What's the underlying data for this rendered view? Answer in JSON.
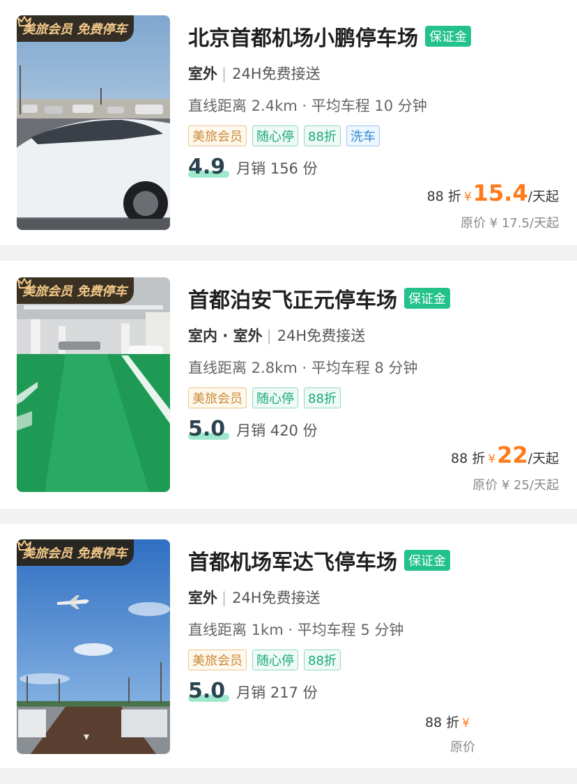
{
  "badge": {
    "text": "美旅会员 免费停车"
  },
  "colors": {
    "deposit_bg": "#23c28a",
    "price": "#ff7a1a",
    "tag_gold": "#c98a3a",
    "tag_green": "#18a878",
    "tag_blue": "#2f87d6",
    "badge_text": "#f3c98a"
  },
  "listings": [
    {
      "name": "北京首都机场小鹏停车场",
      "deposit": "保证金",
      "park_type": "室外",
      "service": "24H免费接送",
      "distance": "直线距离 2.4km · 平均车程 10 分钟",
      "tags": [
        "美旅会员",
        "随心停",
        "88折",
        "洗车"
      ],
      "rating": "4.9",
      "sales": "月销 156 份",
      "discount": "88 折",
      "currency": "¥",
      "price": "15.4",
      "unit": "/天起",
      "original": "原价 ¥ 17.5/天起",
      "image": "outdoor lot with white sedan"
    },
    {
      "name": "首都泊安飞正元停车场",
      "deposit": "保证金",
      "park_type": "室内 · 室外",
      "service": "24H免费接送",
      "distance": "直线距离 2.8km · 平均车程 8 分钟",
      "tags": [
        "美旅会员",
        "随心停",
        "88折"
      ],
      "rating": "5.0",
      "sales": "月销 420 份",
      "discount": "88 折",
      "currency": "¥",
      "price": "22",
      "unit": "/天起",
      "original": "原价 ¥ 25/天起",
      "image": "indoor garage with green floor"
    },
    {
      "name": "首都机场军达飞停车场",
      "deposit": "保证金",
      "park_type": "室外",
      "service": "24H免费接送",
      "distance": "直线距离 1km · 平均车程 5 分钟",
      "tags": [
        "美旅会员",
        "随心停",
        "88折"
      ],
      "rating": "5.0",
      "sales": "月销 217 份",
      "discount": "88 折",
      "currency": "¥",
      "price": "",
      "unit": "",
      "original": "原价",
      "image": "outdoor lot with airplane in sky"
    }
  ]
}
